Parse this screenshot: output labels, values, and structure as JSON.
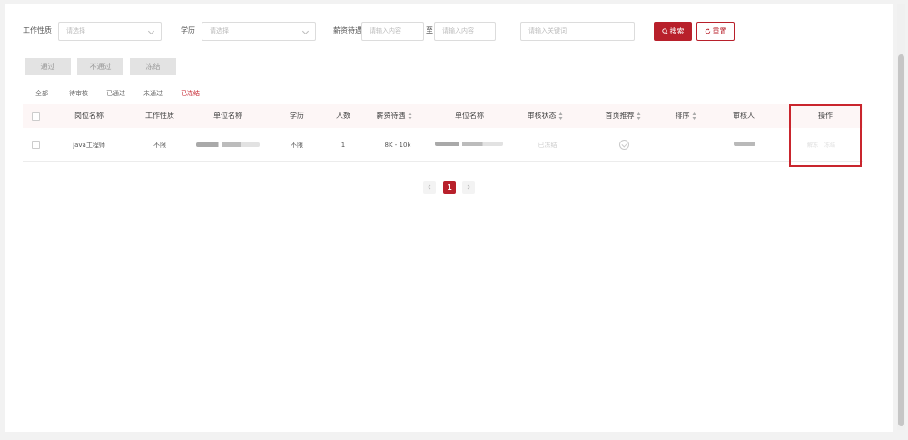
{
  "filters": {
    "job_type": {
      "label": "工作性质",
      "placeholder": "请选择"
    },
    "education": {
      "label": "学历",
      "placeholder": "请选择"
    },
    "salary": {
      "label": "薪资待遇",
      "min_placeholder": "请输入内容",
      "separator": "至",
      "max_placeholder": "请输入内容"
    },
    "keyword": {
      "placeholder": "请输入关键词"
    },
    "search_button": "搜索",
    "reset_button": "重置",
    "icons": {
      "search": "search-icon",
      "reset": "refresh-icon",
      "dropdown": "chevron-down-icon"
    }
  },
  "actions": {
    "approve": "通过",
    "reject": "不通过",
    "freeze": "冻结"
  },
  "status_tabs": {
    "items": [
      "全部",
      "待审核",
      "已通过",
      "未通过",
      "已冻结"
    ],
    "active_index": 4
  },
  "table": {
    "columns": [
      "岗位名称",
      "工作性质",
      "单位名称",
      "学历",
      "人数",
      "薪资待遇",
      "单位名称",
      "审核状态",
      "首页推荐",
      "排序",
      "审核人",
      "操作"
    ],
    "sortable_columns": [
      "薪资待遇",
      "审核状态",
      "首页推荐",
      "排序"
    ],
    "rows": [
      {
        "job_name": "java工程师",
        "job_type": "不限",
        "education": "不限",
        "headcount": "1",
        "salary": "8K - 10k",
        "review_status": "已冻结",
        "homepage_recommend_icon": "check-circle-icon",
        "operations": [
          "解冻",
          "冻结"
        ]
      }
    ]
  },
  "pagination": {
    "current_page": "1",
    "prev_icon": "chevron-left-icon",
    "next_icon": "chevron-right-icon"
  },
  "colors": {
    "primary": "#b8202b",
    "highlight_box": "#c9252d",
    "header_bg": "#fdf6f6"
  }
}
